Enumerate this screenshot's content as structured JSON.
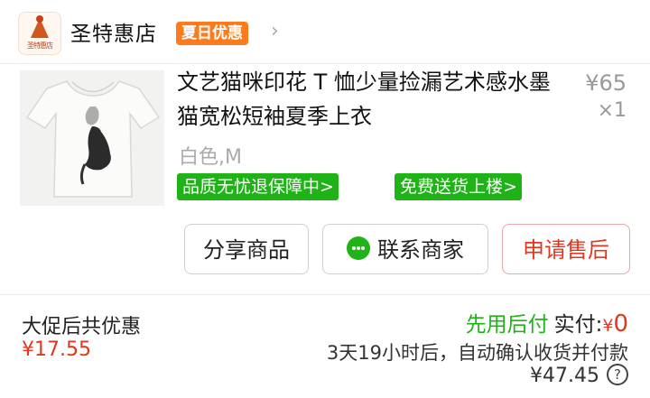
{
  "shop": {
    "name": "圣特惠店",
    "logo_text": "圣特惠店",
    "promo_badge": "夏日优惠"
  },
  "product": {
    "title": "文艺猫咪印花 T 恤少量捡漏艺术感水墨猫宽松短袖夏季上衣",
    "price": "¥65",
    "quantity": "×1",
    "sku": "白色,M",
    "tags": [
      "品质无忧退保障中>",
      "免费送货上楼>"
    ],
    "image": "white-tshirt-ink-cat-print"
  },
  "actions": {
    "share": "分享商品",
    "contact": "联系商家",
    "after_sales": "申请售后"
  },
  "summary": {
    "discount_label": "大促后共优惠",
    "discount_value": "¥17.55",
    "pay_later": "先用后付",
    "actual_label": "实付:",
    "actual_currency": "¥",
    "actual_amount": "0",
    "confirm_note": "3天19小时后，自动确认收货并付款",
    "total": "¥47.45"
  },
  "colors": {
    "accent_green": "#20b318",
    "accent_red": "#e3361f",
    "promo_orange": "#ff7a1a"
  },
  "icons": [
    "chevron-right-icon",
    "chat-icon",
    "help-icon"
  ]
}
